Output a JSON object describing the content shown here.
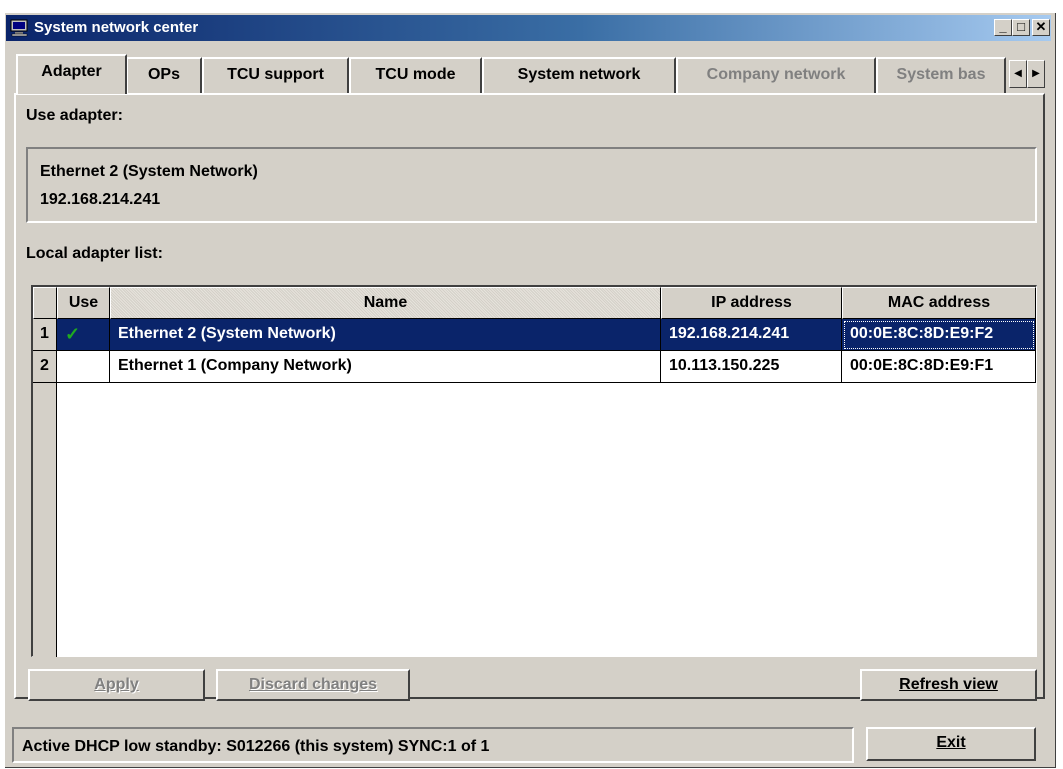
{
  "window": {
    "title": "System network center",
    "controls": {
      "minimize": "_",
      "maximize": "□",
      "close": "✕"
    }
  },
  "tabs": [
    {
      "label": "Adapter",
      "active": true,
      "enabled": true
    },
    {
      "label": "OPs",
      "active": false,
      "enabled": true
    },
    {
      "label": "TCU support",
      "active": false,
      "enabled": true
    },
    {
      "label": "TCU mode",
      "active": false,
      "enabled": true
    },
    {
      "label": "System network",
      "active": false,
      "enabled": true
    },
    {
      "label": "Company network",
      "active": false,
      "enabled": false
    },
    {
      "label": "System bas",
      "active": false,
      "enabled": false
    }
  ],
  "tab_scroll": {
    "left": "◀",
    "right": "▶"
  },
  "use_adapter": {
    "label": "Use adapter:",
    "name": "Ethernet 2 (System Network)",
    "ip": "192.168.214.241"
  },
  "adapter_list": {
    "label": "Local adapter list:",
    "columns": [
      "Use",
      "Name",
      "IP address",
      "MAC address"
    ],
    "rows": [
      {
        "num": "1",
        "use": "✓",
        "name": "Ethernet 2 (System Network)",
        "ip": "192.168.214.241",
        "mac": "00:0E:8C:8D:E9:F2",
        "selected": true
      },
      {
        "num": "2",
        "use": "",
        "name": "Ethernet 1 (Company Network)",
        "ip": "10.113.150.225",
        "mac": "00:0E:8C:8D:E9:F1",
        "selected": false
      }
    ]
  },
  "buttons": {
    "apply": "Apply",
    "discard": "Discard changes",
    "refresh": "Refresh view",
    "exit": "Exit"
  },
  "status_bar": "Active DHCP low standby: S012266 (this system) SYNC:1 of 1",
  "colors": {
    "title_bar": "#0a246a",
    "selection": "#0a246a",
    "face": "#d4d0c8",
    "check": "#1faa1f"
  }
}
